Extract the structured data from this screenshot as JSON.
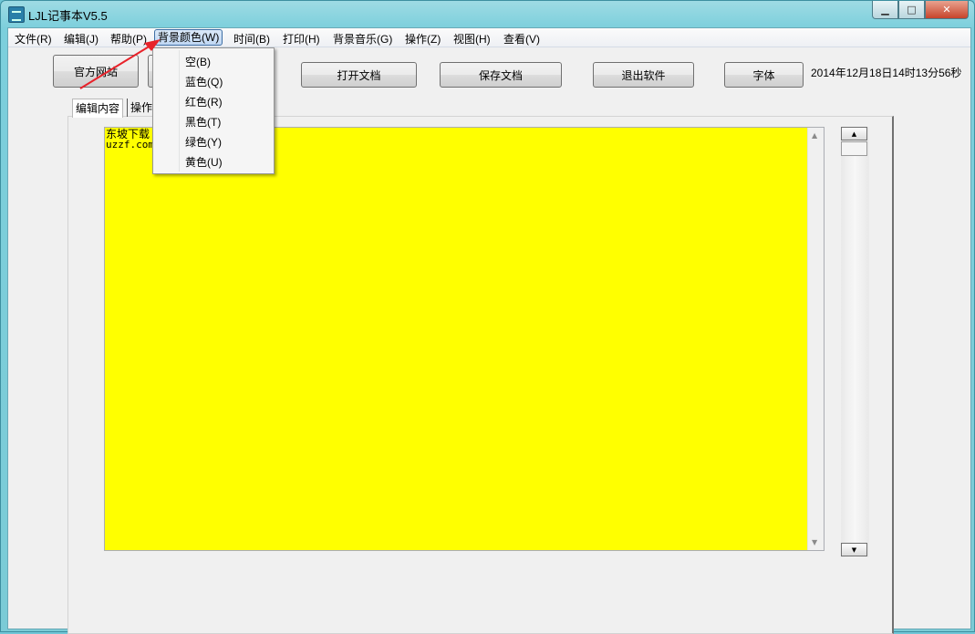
{
  "window": {
    "title": "LJL记事本V5.5"
  },
  "menu": {
    "items": [
      "文件(R)",
      "编辑(J)",
      "帮助(P)",
      "背景颜色(W)",
      "时间(B)",
      "打印(H)",
      "背景音乐(G)",
      "操作(Z)",
      "视图(H)",
      "查看(V)"
    ],
    "active_index": 3
  },
  "dropdown": {
    "items": [
      "空(B)",
      "蓝色(Q)",
      "红色(R)",
      "黑色(T)",
      "绿色(Y)",
      "黄色(U)"
    ]
  },
  "toolbar": {
    "official_site": "官方网站",
    "open_doc": "打开文档",
    "save_doc": "保存文档",
    "exit": "退出软件",
    "font": "字体"
  },
  "datetime": "2014年12月18日14时13分56秒",
  "tabs": [
    "编辑内容",
    "操作"
  ],
  "editor": {
    "lines": [
      "东坡下载",
      "uzzf.com"
    ],
    "background": "#ffff00"
  },
  "colors": {
    "annotation_arrow": "#e8222a",
    "editor_bg": "#ffff00"
  }
}
